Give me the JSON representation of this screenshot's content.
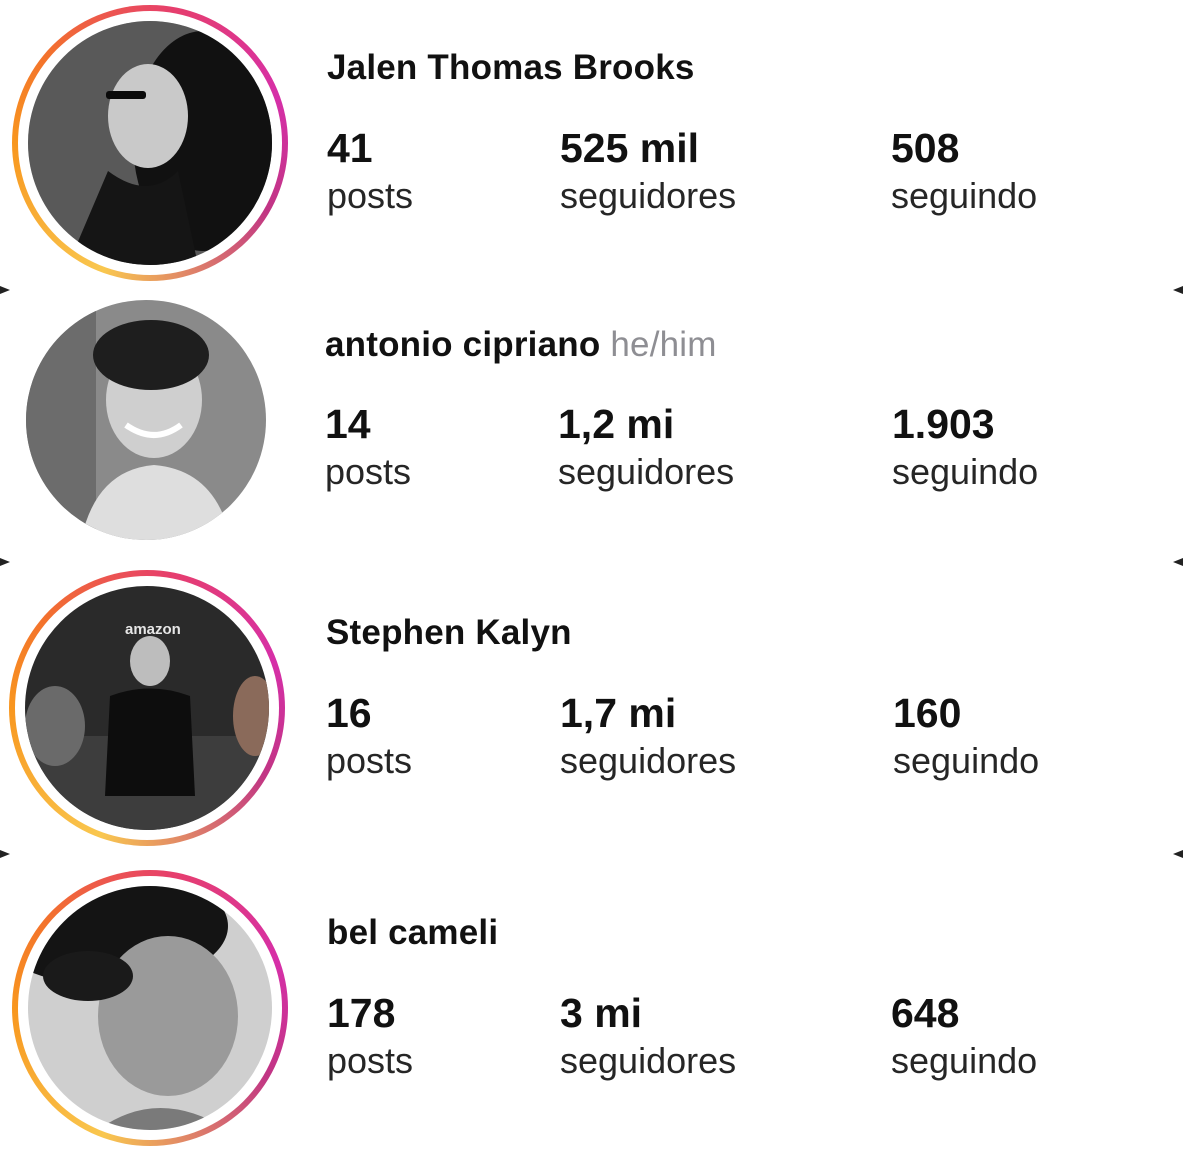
{
  "profiles": [
    {
      "name": "Jalen Thomas Brooks",
      "pronouns": "",
      "stats": {
        "posts_value": "41",
        "posts_label": "posts",
        "followers_value": "525 mil",
        "followers_label": "seguidores",
        "following_value": "508",
        "following_label": "seguindo"
      },
      "has_story_ring": true
    },
    {
      "name": "antonio cipriano",
      "pronouns": "he/him",
      "stats": {
        "posts_value": "14",
        "posts_label": "posts",
        "followers_value": "1,2 mi",
        "followers_label": "seguidores",
        "following_value": "1.903",
        "following_label": "seguindo"
      },
      "has_story_ring": false
    },
    {
      "name": "Stephen Kalyn",
      "pronouns": "",
      "stats": {
        "posts_value": "16",
        "posts_label": "posts",
        "followers_value": "1,7 mi",
        "followers_label": "seguidores",
        "following_value": "160",
        "following_label": "seguindo"
      },
      "has_story_ring": true,
      "photo_text": "amazon"
    },
    {
      "name": "bel cameli",
      "pronouns": "",
      "stats": {
        "posts_value": "178",
        "posts_label": "posts",
        "followers_value": "3 mi",
        "followers_label": "seguidores",
        "following_value": "648",
        "following_label": "seguindo"
      },
      "has_story_ring": true
    }
  ],
  "colors": {
    "story_ring_start": "#f9c74f",
    "story_ring_end": "#c13584",
    "pronouns": "#8e8e93"
  }
}
